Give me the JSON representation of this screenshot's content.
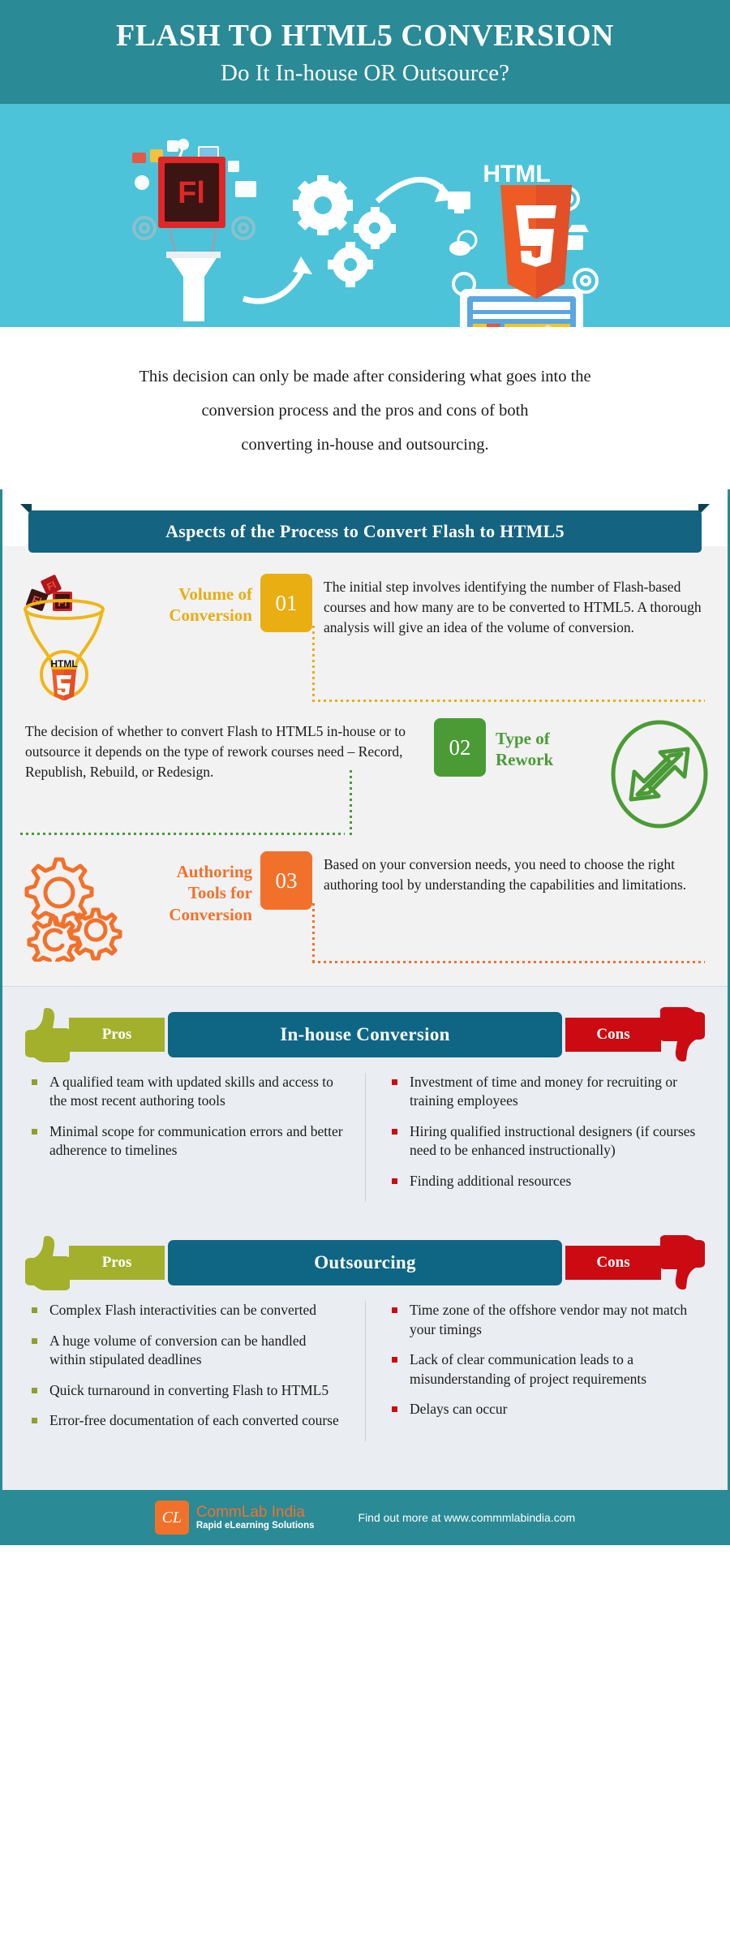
{
  "header": {
    "title": "FLASH TO HTML5 CONVERSION",
    "subtitle": "Do It In-house OR Outsource?"
  },
  "hero": {
    "flash_label": "Fl",
    "html_label": "HTML",
    "html_number": "5"
  },
  "intro": {
    "line1": "This decision can only be made after considering what goes into the",
    "line2": "conversion process and the pros and cons of both",
    "line3": "converting in-house and outsourcing."
  },
  "section_banner": {
    "title": "Aspects of the Process to Convert  Flash to HTML5"
  },
  "steps": [
    {
      "number": "01",
      "title": "Volume of Conversion",
      "description": "The initial step involves identifying the number of Flash-based courses and how many are to be converted to HTML5. A thorough analysis will give an idea of the volume of conversion.",
      "color": "#e9ae12",
      "icon": "funnel-html5-icon"
    },
    {
      "number": "02",
      "title": "Type of Rework",
      "description": "The decision of whether to convert Flash to HTML5 in-house or to outsource it depends on the type of rework courses need – Record, Republish, Rebuild, or Redesign.",
      "color": "#4a9b35",
      "icon": "recycle-arrows-icon"
    },
    {
      "number": "03",
      "title": "Authoring Tools for Conversion",
      "description": "Based on your conversion needs, you need to choose the right authoring tool by understanding the capabilities and limitations.",
      "color": "#f2712a",
      "icon": "gears-icon"
    }
  ],
  "comparisons": [
    {
      "title": "In-house Conversion",
      "pros_label": "Pros",
      "cons_label": "Cons",
      "pros": [
        "A qualified team with updated skills and access to the most recent authoring tools",
        "Minimal scope for communication errors and better adherence to timelines"
      ],
      "cons": [
        "Investment of time and money for recruiting or training employees",
        "Hiring qualified instructional designers (if courses need to be enhanced instructionally)",
        "Finding additional resources"
      ]
    },
    {
      "title": "Outsourcing",
      "pros_label": "Pros",
      "cons_label": "Cons",
      "pros": [
        "Complex Flash interactivities can be converted",
        "A huge volume of conversion can be handled within stipulated deadlines",
        "Quick turnaround in converting Flash to HTML5",
        "Error-free documentation of each converted course"
      ],
      "cons": [
        "Time zone of the offshore vendor may not match your timings",
        "Lack of clear communication leads to a misunderstanding of project requirements",
        "Delays can occur"
      ]
    }
  ],
  "footer": {
    "brand_mark": "CL",
    "brand_name": "CommLab India",
    "brand_tagline": "Rapid eLearning Solutions",
    "note": "Find out more at www.commmlabindia.com"
  },
  "colors": {
    "header_teal": "#2a8a96",
    "hero_blue": "#4cc3d9",
    "banner_blue": "#146380",
    "yellow": "#e9ae12",
    "green": "#4a9b35",
    "orange": "#f2712a",
    "pros_olive": "#a2b02c",
    "cons_red": "#cc0a12",
    "panel_bg": "#f2f2f2",
    "proscons_bg": "#eaedf1"
  }
}
